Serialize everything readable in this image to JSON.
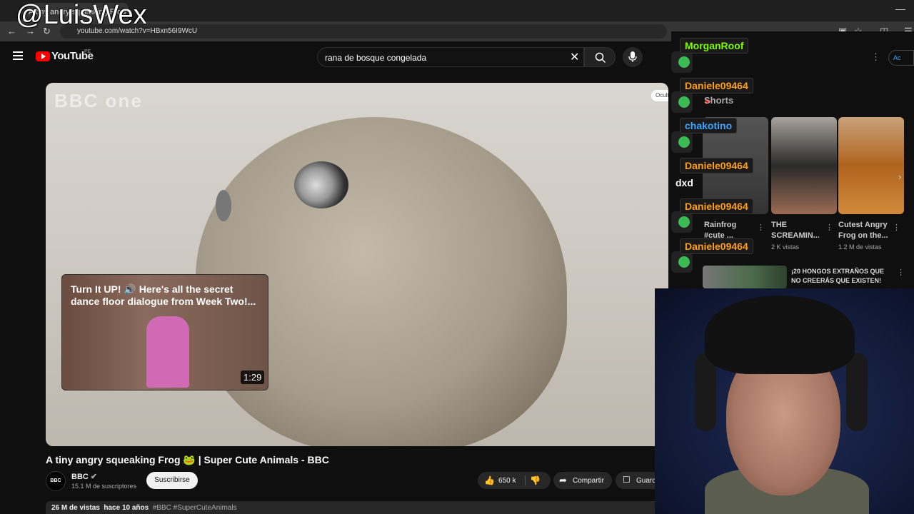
{
  "watermark": "@LuisWex",
  "browser": {
    "url": "youtube.com/watch?v=HBxn56I9WcU",
    "tab_label": "A tiny angry squeaking Frog"
  },
  "youtube": {
    "logo_text": "YouTube",
    "region": "PE",
    "search_value": "rana de bosque congelada"
  },
  "video": {
    "watermark_logo": "BBC one",
    "ocultar": "Ocultar",
    "title": "A tiny angry squeaking Frog 🐸 | Super Cute Animals - BBC"
  },
  "miniplayer": {
    "title": "Turn It UP! 🔊 Here's all the secret dance floor dialogue from Week Two!...",
    "duration": "1:29"
  },
  "channel": {
    "avatar_text": "BBC",
    "name": "BBC",
    "subscribers": "15.1 M de suscriptores",
    "subscribe_label": "Suscribirse"
  },
  "actions": {
    "likes": "650 k",
    "share_label": "Compartir",
    "save_label": "Guard"
  },
  "description": {
    "views": "26 M de vistas",
    "age": "hace 10 años",
    "tags": "#BBC #SuperCuteAnimals"
  },
  "sidebar": {
    "account_label": "Ac",
    "shorts_label": "Shorts",
    "shorts": [
      {
        "title": "Rainfrog #cute ...",
        "views": ""
      },
      {
        "title": "THE SCREAMIN...",
        "views": "2 K vistas"
      },
      {
        "title": "Cutest Angry Frog on the...",
        "views": "1.2 M de vistas"
      }
    ],
    "recommended": {
      "title": "¡20 HONGOS EXTRAÑOS QUE NO CREERÁS QUE EXISTEN!"
    }
  },
  "chat": {
    "messages": [
      {
        "user": "MorganRoof",
        "color": "#7cfc00"
      },
      {
        "user": "Daniele09464",
        "color": "#ff9f1c"
      },
      {
        "user": "chakotino",
        "color": "#3ea6ff"
      },
      {
        "user": "Daniele09464",
        "color": "#ff9f1c"
      },
      {
        "user": "Daniele09464",
        "color": "#ff9f1c"
      },
      {
        "user": "Daniele09464",
        "color": "#ff9f1c"
      }
    ],
    "text_message": "dxd"
  },
  "colors": {
    "youtube_red": "#ff0000",
    "background": "#0f0f0f"
  }
}
